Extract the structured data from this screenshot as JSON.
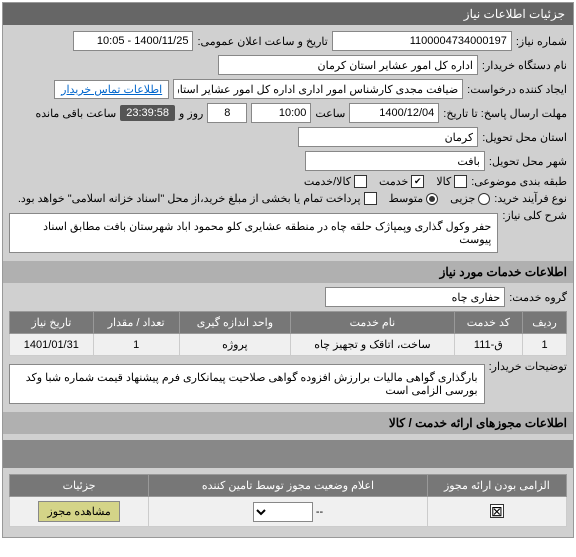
{
  "header": {
    "title": "جزئیات اطلاعات نیاز"
  },
  "fields": {
    "need_number_label": "شماره نیاز:",
    "need_number_value": "1100004734000197",
    "announce_date_label": "تاریخ و ساعت اعلان عمومی:",
    "announce_date_value": "1400/11/25 - 10:05",
    "buyer_org_label": "نام دستگاه خریدار:",
    "buyer_org_value": "اداره کل امور عشایر استان کرمان",
    "requester_label": "ایجاد کننده درخواست:",
    "requester_value": "ضیافت مجدی کارشناس امور اداری اداره کل امور عشایر استان کرمان",
    "contact_link": "اطلاعات تماس خریدار",
    "deadline_label": "مهلت ارسال پاسخ: تا تاریخ:",
    "deadline_date": "1400/12/04",
    "time_label": "ساعت",
    "deadline_time": "10:00",
    "days_remaining": "8",
    "days_and_label": "روز و",
    "countdown": "23:39:58",
    "countdown_suffix": "ساعت باقی مانده",
    "province_label": "استان محل تحویل:",
    "province_value": "کرمان",
    "city_label": "شهر محل تحویل:",
    "city_value": "بافت",
    "subject_type_label": "طبقه بندی موضوعی:",
    "goods_label": "کالا",
    "service_label": "خدمت",
    "goods_service_label": "کالا/خدمت",
    "purchase_type_label": "نوع فرآیند خرید:",
    "minor_label": "جزیی",
    "medium_label": "متوسط",
    "payment_note": "پرداخت تمام یا بخشی از مبلغ خرید،از محل \"اسناد خزانه اسلامی\" خواهد بود.",
    "desc_label": "شرح کلی نیاز:",
    "desc_text": "حفر وکول گذاری وپمپاژک حلقه چاه در منطقه عشایری کلو محمود اباد شهرستان بافت مطابق اسناد پیوست",
    "services_section": "اطلاعات خدمات مورد نیاز",
    "service_group_label": "گروه خدمت:",
    "service_group_value": "حفاری چاه",
    "buyer_notes_label": "توضیحات خریدار:",
    "buyer_notes_text": "بارگذاری گواهی مالیات برارزش افزوده گواهی صلاحیت پیمانکاری فرم پیشنهاد قیمت شماره شبا وکد بورسی الزامی است",
    "permits_section": "اطلاعات مجوزهای ارائه خدمت / کالا"
  },
  "table1": {
    "headers": [
      "ردیف",
      "کد خدمت",
      "نام خدمت",
      "واحد اندازه گیری",
      "تعداد / مقدار",
      "تاریخ نیاز"
    ],
    "rows": [
      {
        "idx": "1",
        "code": "ق-111",
        "name": "ساخت، اتاقک و تجهیز چاه",
        "unit": "پروژه",
        "qty": "1",
        "date": "1401/01/31"
      }
    ]
  },
  "table2": {
    "headers": [
      "الزامی بودن ارائه مجوز",
      "اعلام وضعیت مجوز توسط تامین کننده",
      "جزئیات"
    ],
    "row": {
      "required_checked": true,
      "status_value": "--",
      "details_btn": "مشاهده مجوز"
    }
  }
}
